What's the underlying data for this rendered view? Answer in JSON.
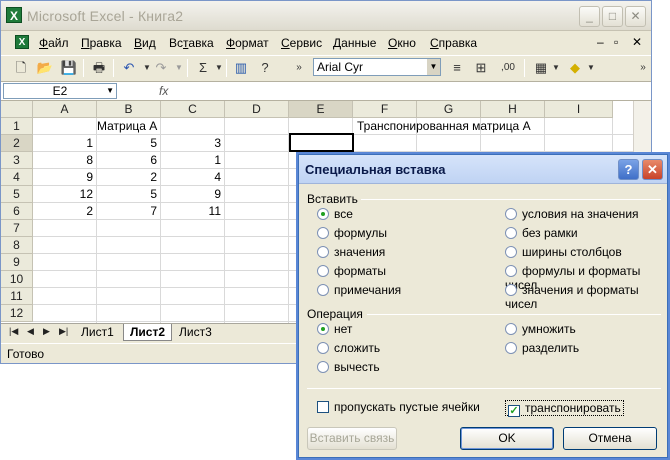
{
  "window": {
    "title": "Microsoft Excel - Книга2"
  },
  "menu": [
    "Файл",
    "Правка",
    "Вид",
    "Вставка",
    "Формат",
    "Сервис",
    "Данные",
    "Окно",
    "Справка"
  ],
  "menu_underline": [
    "Ф",
    "П",
    "В",
    "т",
    "Ф",
    "С",
    "Д",
    "О",
    "С"
  ],
  "toolbar": {
    "font_name": "Arial Cyr"
  },
  "formula_bar": {
    "name_box": "E2",
    "fx_label": "fx"
  },
  "columns": [
    "A",
    "B",
    "C",
    "D",
    "E",
    "F",
    "G",
    "H",
    "I"
  ],
  "rows": [
    "1",
    "2",
    "3",
    "4",
    "5",
    "6",
    "7",
    "8",
    "9",
    "10",
    "11",
    "12"
  ],
  "cells": {
    "matrix_a_title": "Матрица А",
    "transposed_title": "Транспонированная матрица А",
    "matrix": [
      [
        1,
        5,
        3
      ],
      [
        8,
        6,
        1
      ],
      [
        9,
        2,
        4
      ],
      [
        12,
        5,
        9
      ],
      [
        2,
        7,
        11
      ]
    ]
  },
  "sheets": [
    "Лист1",
    "Лист2",
    "Лист3"
  ],
  "active_sheet": "Лист2",
  "status": "Готово",
  "dialog": {
    "title": "Специальная вставка",
    "paste_group": "Вставить",
    "paste_left": [
      "все",
      "формулы",
      "значения",
      "форматы",
      "примечания"
    ],
    "paste_right": [
      "условия на значения",
      "без рамки",
      "ширины столбцов",
      "формулы и форматы чисел",
      "значения и форматы чисел"
    ],
    "paste_selected": "все",
    "operation_group": "Операция",
    "op_left": [
      "нет",
      "сложить",
      "вычесть"
    ],
    "op_right": [
      "умножить",
      "разделить"
    ],
    "op_selected": "нет",
    "skip_blanks": "пропускать пустые ячейки",
    "transpose": "транспонировать",
    "transpose_checked": true,
    "paste_link": "Вставить связь",
    "ok": "OK",
    "cancel": "Отмена"
  }
}
